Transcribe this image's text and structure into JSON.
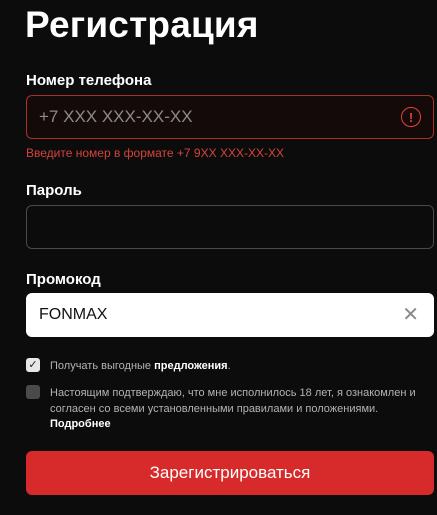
{
  "title": "Регистрация",
  "phone": {
    "label": "Номер телефона",
    "value": "",
    "placeholder": "+7 XXX XXX-XX-XX",
    "error": "Введите номер в формате +7 9XX XXX-XX-XX",
    "icon": "alert-circle-icon"
  },
  "password": {
    "label": "Пароль",
    "value": "",
    "placeholder": ""
  },
  "promo": {
    "label": "Промокод",
    "value": "FONMAX",
    "clear_icon": "close-icon"
  },
  "offers_checkbox": {
    "checked": true,
    "text": "Получать выгодные",
    "link": "предложения",
    "suffix": "."
  },
  "terms_checkbox": {
    "checked": false,
    "text": "Настоящим подтверждаю, что мне исполнилось 18 лет, я ознакомлен и согласен со всеми установленными правилами и положениями.",
    "more_link": "Подробнее"
  },
  "submit_label": "Зарегистрироваться",
  "colors": {
    "background": "#0c0c0c",
    "accent": "#d72a2a",
    "error": "#d4433b"
  }
}
